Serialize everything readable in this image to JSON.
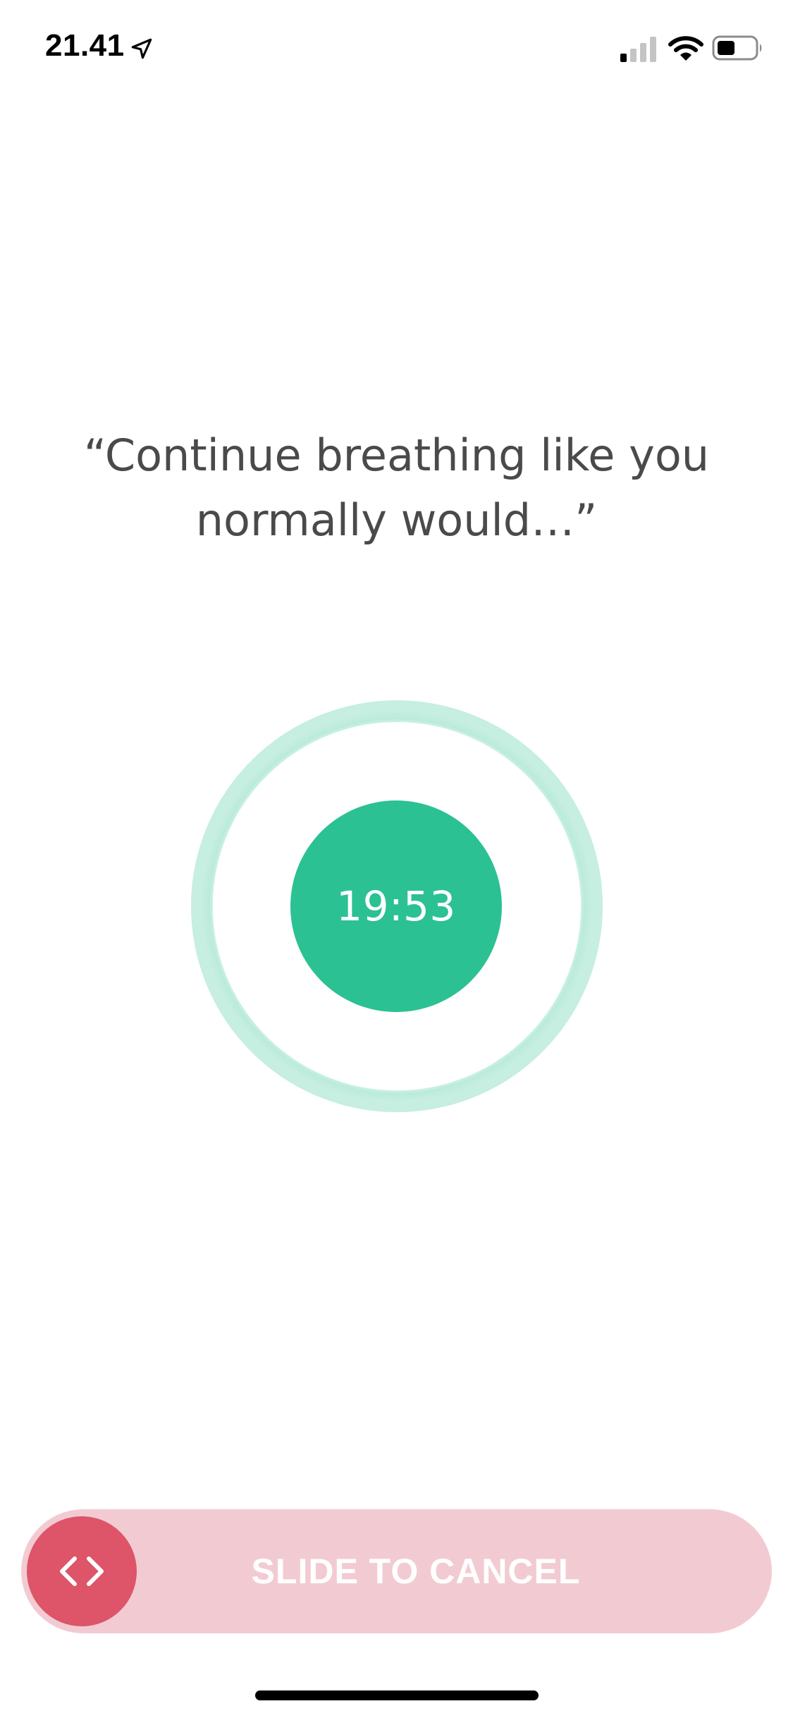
{
  "status_bar": {
    "time": "21.41",
    "icons": [
      "location-arrow-icon",
      "signal-icon",
      "wifi-icon",
      "battery-icon"
    ]
  },
  "instruction": {
    "text": "“Continue breathing like you normally would…”"
  },
  "timer": {
    "value": "19:53"
  },
  "slider": {
    "label": "SLIDE TO CANCEL",
    "handle_icon": "drag-arrows-icon"
  },
  "colors": {
    "accent_green": "#2bc193",
    "ring_green": "#b9eadb",
    "cancel_red": "#de5468",
    "cancel_track": "#f2cbd2",
    "text_gray": "#4a4a4a"
  }
}
